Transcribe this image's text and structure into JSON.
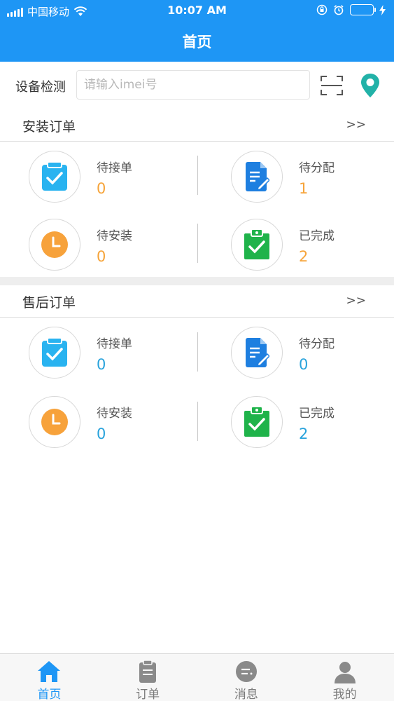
{
  "status_bar": {
    "carrier": "中国移动",
    "time": "10:07 AM"
  },
  "nav": {
    "title": "首页"
  },
  "search": {
    "label": "设备检测",
    "placeholder": "请输入imei号",
    "value": ""
  },
  "install_orders": {
    "title": "安装订单",
    "more": ">>",
    "items": [
      {
        "label": "待接单",
        "count": "0",
        "icon": "clipboard-check-icon"
      },
      {
        "label": "待分配",
        "count": "1",
        "icon": "document-edit-icon"
      },
      {
        "label": "待安装",
        "count": "0",
        "icon": "clock-icon"
      },
      {
        "label": "已完成",
        "count": "2",
        "icon": "clipboard-done-icon"
      }
    ]
  },
  "after_sale_orders": {
    "title": "售后订单",
    "more": ">>",
    "items": [
      {
        "label": "待接单",
        "count": "0",
        "icon": "clipboard-check-icon"
      },
      {
        "label": "待分配",
        "count": "0",
        "icon": "document-edit-icon"
      },
      {
        "label": "待安装",
        "count": "0",
        "icon": "clock-icon"
      },
      {
        "label": "已完成",
        "count": "2",
        "icon": "clipboard-done-icon"
      }
    ]
  },
  "tabbar": {
    "tabs": [
      {
        "label": "首页",
        "icon": "home-icon",
        "active": true
      },
      {
        "label": "订单",
        "icon": "order-icon",
        "active": false
      },
      {
        "label": "消息",
        "icon": "message-icon",
        "active": false
      },
      {
        "label": "我的",
        "icon": "user-icon",
        "active": false
      }
    ]
  },
  "colors": {
    "primary": "#1e96f5",
    "install_count": "#f6a43a",
    "after_sale_count": "#29a3dc",
    "icon_blue": "#29b3f0",
    "icon_doc": "#1e7fe0",
    "icon_orange": "#f7a23b",
    "icon_green": "#1fb34a"
  }
}
